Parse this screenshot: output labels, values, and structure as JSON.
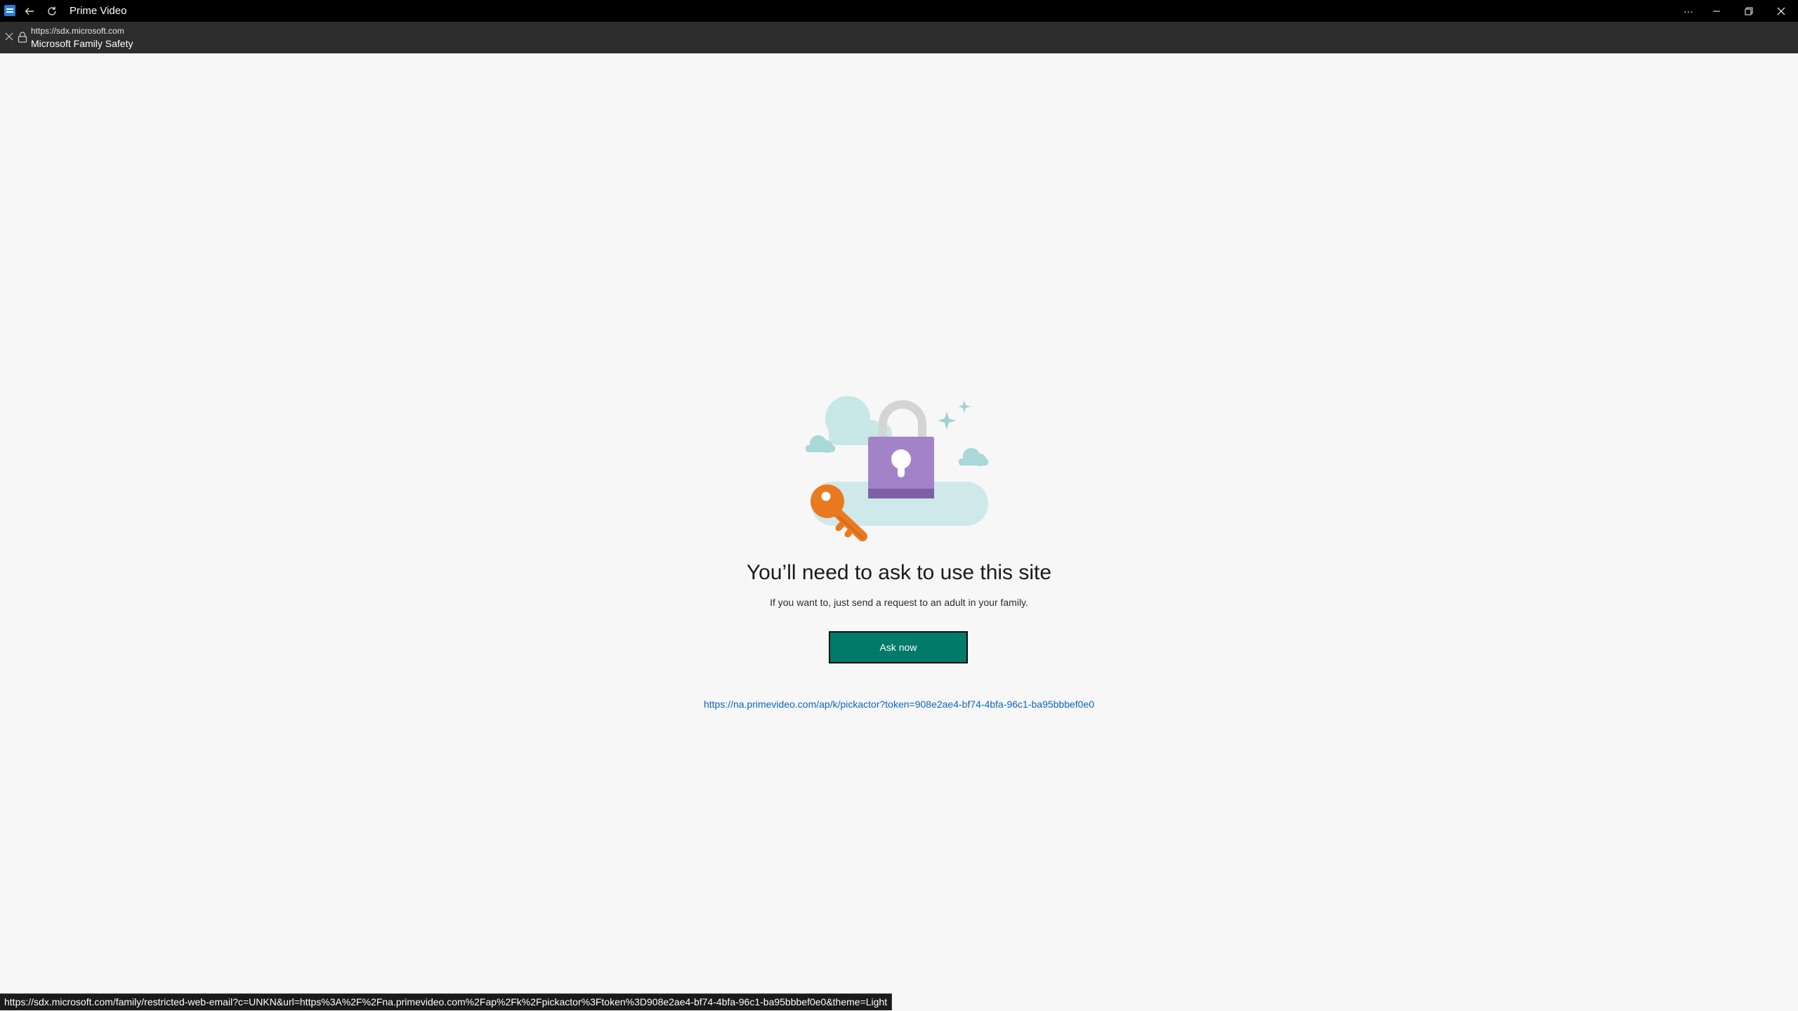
{
  "titlebar": {
    "app_title": "Prime Video",
    "icons": {
      "app": "browser-app-icon",
      "back": "back-arrow-icon",
      "refresh": "refresh-icon",
      "more": "more-options-icon",
      "minimize": "minimize-icon",
      "restore": "restore-icon",
      "close": "close-icon"
    }
  },
  "addressbar": {
    "url": "https://sdx.microsoft.com",
    "page_title": "Microsoft Family Safety",
    "icons": {
      "close": "close-icon",
      "lock": "lock-icon"
    }
  },
  "main": {
    "headline": "You’ll need to ask to use this site",
    "subtext": "If you want to, just send a request to an adult in your family.",
    "ask_button_label": "Ask now",
    "blocked_url": "https://na.primevideo.com/ap/k/pickactor?token=908e2ae4-bf74-4bfa-96c1-ba95bbbef0e0",
    "illustration": "padlock-and-key-illustration"
  },
  "statusbar": {
    "hover_url": "https://sdx.microsoft.com/family/restricted-web-email?c=UNKN&url=https%3A%2F%2Fna.primevideo.com%2Fap%2Fk%2Fpickactor%3Ftoken%3D908e2ae4-bf74-4bfa-96c1-ba95bbbef0e0&theme=Light"
  },
  "colors": {
    "titlebar_bg": "#000000",
    "addressbar_bg": "#2d2d2d",
    "page_bg": "#f7f7f7",
    "button_bg": "#007a6a",
    "link": "#0a66c2",
    "lock_purple": "#9b7cc0",
    "key_orange": "#ea7a1f",
    "cloud_teal": "#bfe3e3"
  }
}
